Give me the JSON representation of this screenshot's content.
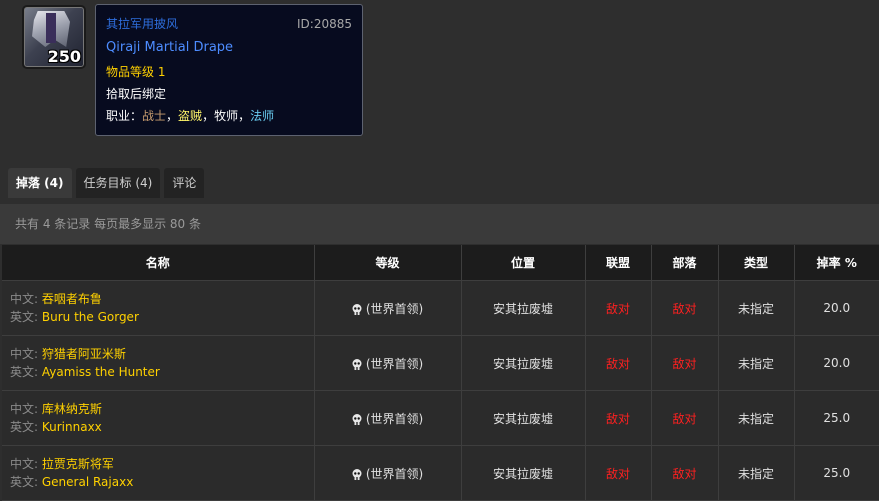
{
  "item": {
    "icon_count": "250",
    "cn_name": "其拉军用披风",
    "id_text": "ID:20885",
    "en_name": "Qiraji Martial Drape",
    "item_level": "物品等级 1",
    "binding": "拾取后绑定",
    "classes_label": "职业：",
    "classes": [
      {
        "name": "战士",
        "color": "#c79c6e"
      },
      {
        "name": "盗贼",
        "color": "#fff569"
      },
      {
        "name": "牧师",
        "color": "#ffffff"
      },
      {
        "name": "法师",
        "color": "#69ccf0"
      }
    ],
    "class_sep": "，"
  },
  "tabs": [
    {
      "label": "掉落 (4)",
      "active": true
    },
    {
      "label": "任务目标 (4)",
      "active": false
    },
    {
      "label": "评论",
      "active": false
    }
  ],
  "info_text": "共有 4 条记录 每页最多显示 80 条",
  "table": {
    "headers": [
      "名称",
      "等级",
      "位置",
      "联盟",
      "部落",
      "类型",
      "掉率 %"
    ],
    "cn_label": "中文:",
    "en_label": "英文:",
    "rows": [
      {
        "cn": "吞咽者布鲁",
        "en": "Buru the Gorger",
        "level": "(世界首领)",
        "location": "安其拉废墟",
        "alliance": "敌对",
        "horde": "敌对",
        "type": "未指定",
        "rate": "20.0"
      },
      {
        "cn": "狩猎者阿亚米斯",
        "en": "Ayamiss the Hunter",
        "level": "(世界首领)",
        "location": "安其拉废墟",
        "alliance": "敌对",
        "horde": "敌对",
        "type": "未指定",
        "rate": "20.0"
      },
      {
        "cn": "库林纳克斯",
        "en": "Kurinnaxx",
        "level": "(世界首领)",
        "location": "安其拉废墟",
        "alliance": "敌对",
        "horde": "敌对",
        "type": "未指定",
        "rate": "25.0"
      },
      {
        "cn": "拉贾克斯将军",
        "en": "General Rajaxx",
        "level": "(世界首领)",
        "location": "安其拉废墟",
        "alliance": "敌对",
        "horde": "敌对",
        "type": "未指定",
        "rate": "25.0"
      }
    ]
  }
}
